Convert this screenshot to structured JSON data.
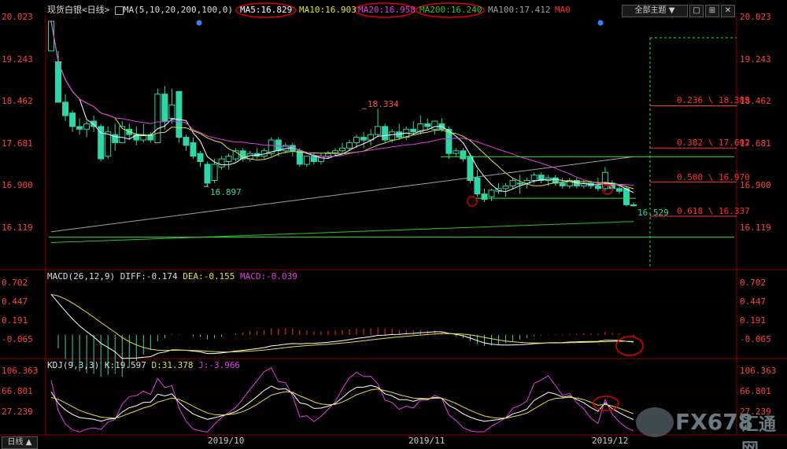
{
  "header": {
    "instrument": "现货白银",
    "period_tag": "<日线>",
    "ma_label": "MA(5,10,20,200,100,0)",
    "ma5": "MA5:16.829",
    "ma10": "MA10:16.903",
    "ma20": "MA20:16.958",
    "ma200": "MA200:16.240",
    "ma100": "MA100:17.412",
    "ma0": "MA0",
    "theme_dropdown": "全部主题",
    "period_button": "日线"
  },
  "macd": {
    "label": "MACD(26,12,9)",
    "diff": "DIFF:-0.174",
    "dea": "DEA:-0.155",
    "macd": "MACD:-0.039",
    "axis": [
      "0.702",
      "0.447",
      "0.191",
      "-0.065"
    ]
  },
  "kdj": {
    "label": "KDJ(9,3,3)",
    "k": "K:19.597",
    "d": "D:31.378",
    "j": "J:-3.966",
    "axis": [
      "106.363",
      "66.801",
      "27.239"
    ]
  },
  "price_axis": [
    "20.023",
    "19.243",
    "18.462",
    "17.681",
    "16.900",
    "16.119"
  ],
  "fibonacci": [
    {
      "label": "0.236 \\ 18.385",
      "price": 18.385
    },
    {
      "label": "0.382 \\ 17.602",
      "price": 17.602
    },
    {
      "label": "0.500 \\ 16.970",
      "price": 16.97
    },
    {
      "label": "0.618 \\ 16.337",
      "price": 16.337
    }
  ],
  "annotations": {
    "high": "18.334",
    "low_oct": "16.897",
    "low_latest": "16.529"
  },
  "time_axis": [
    "2019/10",
    "2019/11",
    "2019/12"
  ],
  "watermark": {
    "brand": "FX678",
    "cn": "汇通网"
  },
  "colors": {
    "up": "#30d5a8",
    "down": "#30d5a8",
    "ma5": "#ffffff",
    "ma10": "#e0e040",
    "ma20": "#e040e0",
    "ma100": "#a0a0a0",
    "ma200": "#30c030",
    "fib": "#ff3030",
    "grid": "#8b0000",
    "axis_text": "#ff4040",
    "highlight": "#e00000"
  },
  "chart_data": {
    "type": "candlestick",
    "price_ylim": [
      16.119,
      20.023
    ],
    "candles": [
      [
        19.4,
        19.95,
        19.4,
        19.95
      ],
      [
        19.2,
        19.4,
        18.45,
        18.45
      ],
      [
        18.45,
        18.6,
        18.1,
        18.2
      ],
      [
        18.25,
        18.3,
        17.9,
        18.0
      ],
      [
        18.0,
        18.15,
        17.85,
        17.95
      ],
      [
        17.95,
        18.1,
        17.8,
        18.05
      ],
      [
        18.1,
        18.2,
        17.9,
        18.0
      ],
      [
        18.0,
        18.05,
        17.35,
        17.4
      ],
      [
        17.45,
        18.0,
        17.4,
        17.9
      ],
      [
        17.85,
        18.05,
        17.55,
        17.7
      ],
      [
        17.7,
        18.1,
        17.7,
        18.0
      ],
      [
        17.95,
        18.05,
        17.75,
        17.85
      ],
      [
        17.85,
        18.0,
        17.65,
        17.75
      ],
      [
        17.75,
        18.05,
        17.7,
        17.85
      ],
      [
        17.85,
        17.9,
        17.7,
        17.75
      ],
      [
        17.7,
        18.7,
        17.7,
        18.6
      ],
      [
        18.6,
        18.75,
        17.95,
        18.1
      ],
      [
        18.15,
        18.7,
        18.05,
        18.4
      ],
      [
        18.65,
        18.65,
        17.7,
        17.8
      ],
      [
        17.8,
        17.85,
        17.55,
        17.65
      ],
      [
        17.7,
        17.8,
        17.4,
        17.45
      ],
      [
        17.5,
        17.55,
        17.25,
        17.35
      ],
      [
        17.3,
        17.35,
        16.89,
        16.95
      ],
      [
        17.0,
        17.4,
        16.95,
        17.3
      ],
      [
        17.25,
        17.45,
        17.2,
        17.4
      ],
      [
        17.35,
        17.5,
        17.2,
        17.45
      ],
      [
        17.4,
        17.6,
        17.35,
        17.55
      ],
      [
        17.55,
        17.6,
        17.35,
        17.4
      ],
      [
        17.4,
        17.55,
        17.35,
        17.5
      ],
      [
        17.5,
        17.6,
        17.4,
        17.45
      ],
      [
        17.45,
        17.6,
        17.4,
        17.55
      ],
      [
        17.5,
        17.8,
        17.45,
        17.75
      ],
      [
        17.75,
        17.8,
        17.45,
        17.55
      ],
      [
        17.55,
        17.7,
        17.5,
        17.65
      ],
      [
        17.65,
        17.7,
        17.45,
        17.55
      ],
      [
        17.55,
        17.6,
        17.25,
        17.3
      ],
      [
        17.3,
        17.45,
        17.25,
        17.45
      ],
      [
        17.45,
        17.5,
        17.3,
        17.35
      ],
      [
        17.35,
        17.5,
        17.3,
        17.45
      ],
      [
        17.45,
        17.55,
        17.4,
        17.5
      ],
      [
        17.5,
        17.6,
        17.45,
        17.55
      ],
      [
        17.55,
        17.7,
        17.5,
        17.6
      ],
      [
        17.6,
        17.75,
        17.55,
        17.7
      ],
      [
        17.7,
        17.85,
        17.6,
        17.8
      ],
      [
        17.8,
        17.9,
        17.6,
        17.75
      ],
      [
        17.75,
        17.95,
        17.65,
        17.85
      ],
      [
        17.85,
        18.33,
        17.8,
        18.0
      ],
      [
        18.0,
        18.05,
        17.7,
        17.75
      ],
      [
        17.75,
        17.95,
        17.7,
        17.9
      ],
      [
        17.9,
        18.05,
        17.75,
        17.8
      ],
      [
        17.8,
        18.0,
        17.75,
        17.95
      ],
      [
        17.95,
        18.1,
        17.85,
        17.9
      ],
      [
        17.9,
        18.2,
        17.85,
        18.05
      ],
      [
        18.05,
        18.15,
        17.95,
        18.0
      ],
      [
        17.95,
        18.1,
        17.85,
        18.1
      ],
      [
        18.05,
        18.15,
        17.9,
        17.95
      ],
      [
        17.95,
        18.0,
        17.4,
        17.5
      ],
      [
        17.5,
        17.6,
        17.45,
        17.55
      ],
      [
        17.55,
        17.6,
        17.35,
        17.4
      ],
      [
        17.45,
        17.5,
        16.95,
        17.0
      ],
      [
        17.05,
        17.2,
        16.7,
        16.75
      ],
      [
        16.75,
        16.85,
        16.6,
        16.65
      ],
      [
        16.7,
        16.85,
        16.62,
        16.82
      ],
      [
        16.8,
        16.95,
        16.75,
        16.85
      ],
      [
        16.85,
        16.95,
        16.7,
        16.9
      ],
      [
        16.9,
        17.05,
        16.85,
        17.0
      ],
      [
        16.95,
        17.1,
        16.75,
        16.95
      ],
      [
        16.95,
        17.05,
        16.85,
        17.0
      ],
      [
        17.0,
        17.15,
        16.95,
        17.1
      ],
      [
        17.1,
        17.15,
        16.95,
        17.0
      ],
      [
        17.0,
        17.1,
        16.9,
        17.05
      ],
      [
        17.05,
        17.1,
        16.9,
        16.95
      ],
      [
        16.95,
        17.05,
        16.85,
        16.9
      ],
      [
        16.9,
        17.05,
        16.85,
        17.0
      ],
      [
        17.0,
        17.05,
        16.85,
        16.9
      ],
      [
        16.9,
        17.0,
        16.85,
        16.95
      ],
      [
        16.95,
        17.0,
        16.85,
        16.9
      ],
      [
        16.9,
        17.05,
        16.8,
        16.85
      ],
      [
        16.85,
        17.25,
        16.8,
        17.15
      ],
      [
        16.95,
        17.0,
        16.8,
        16.85
      ],
      [
        16.85,
        16.9,
        16.75,
        16.8
      ],
      [
        16.85,
        16.9,
        16.52,
        16.55
      ],
      [
        16.55,
        16.6,
        16.52,
        16.53
      ]
    ],
    "macd_ylim": [
      -0.25,
      0.75
    ],
    "kdj_ylim": [
      -15,
      115
    ]
  }
}
